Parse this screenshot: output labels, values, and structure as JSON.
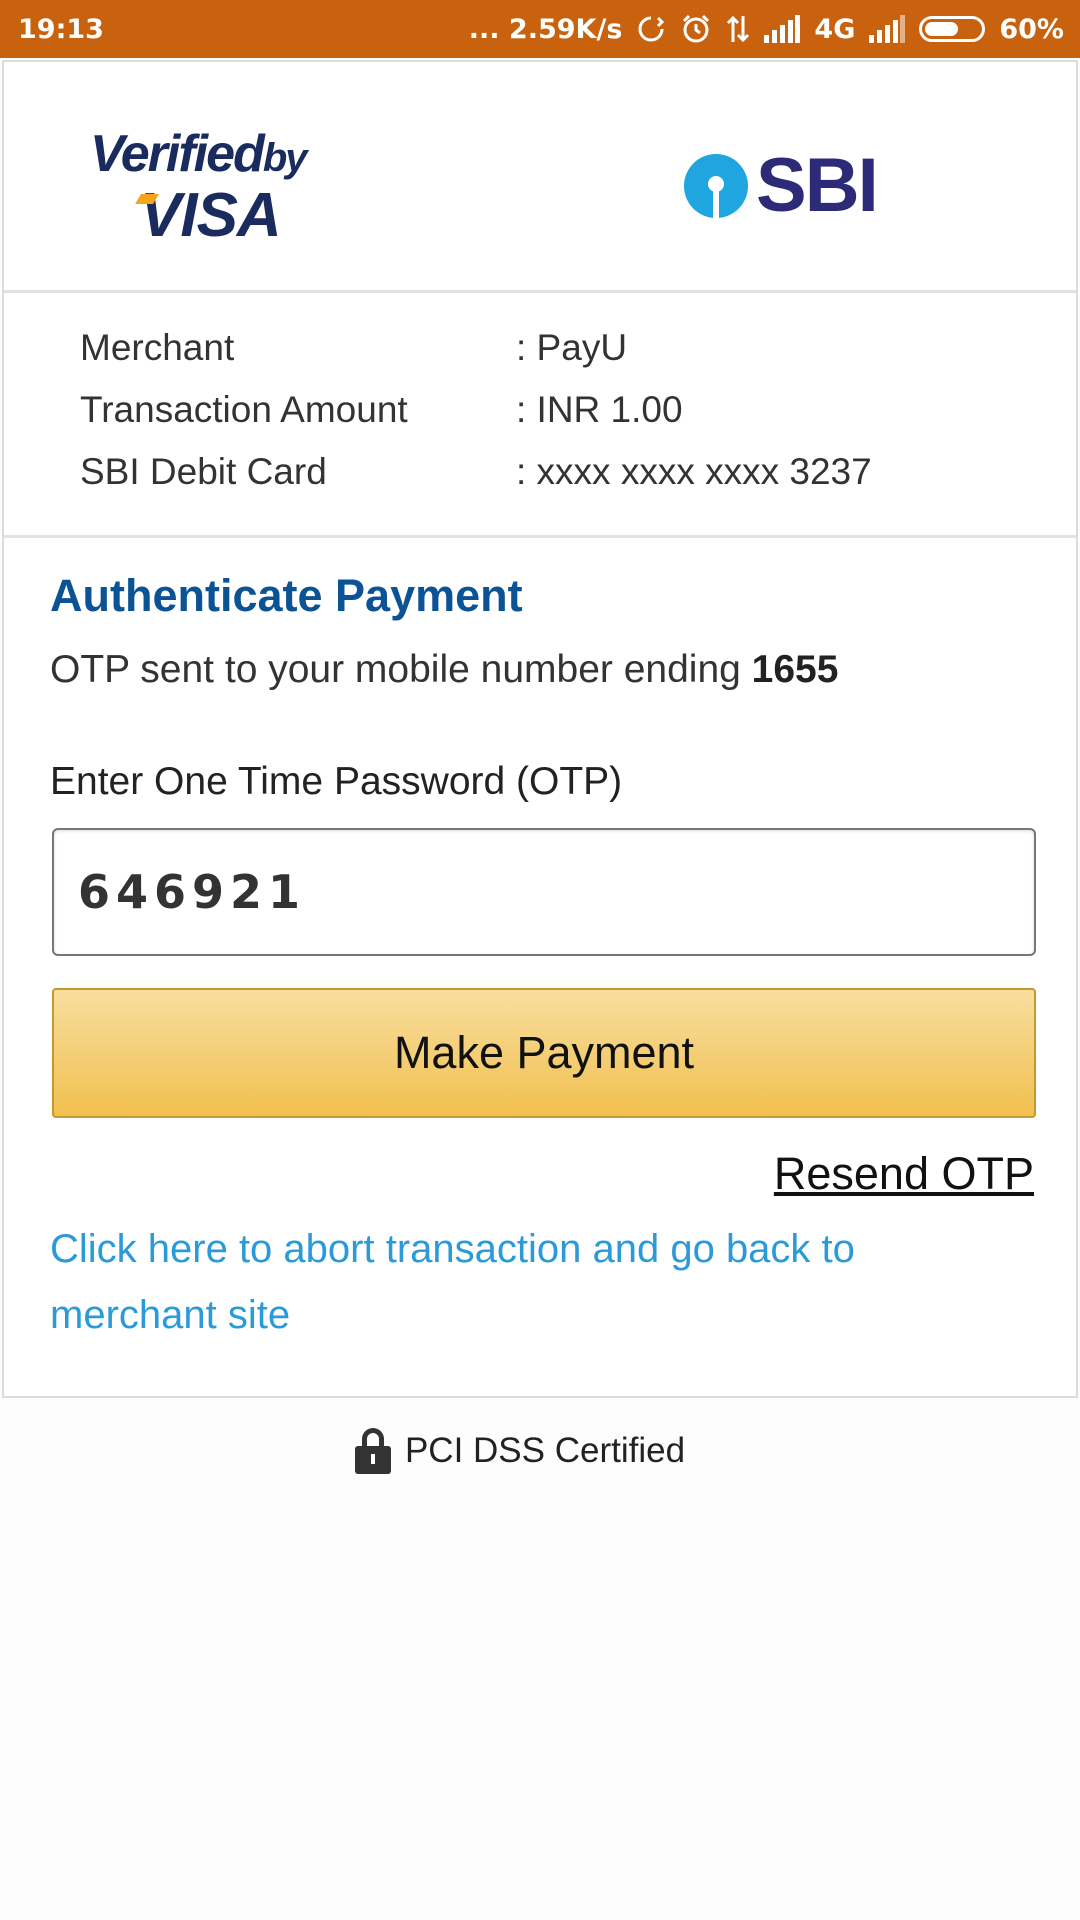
{
  "status_bar": {
    "time": "19:13",
    "network_speed": "... 2.59K/s",
    "network_type": "4G",
    "battery": "60%",
    "battery_level": 0.6,
    "icons": [
      "sync-icon",
      "alarm-icon",
      "data-transfer-icon",
      "signal-icon",
      "signal-icon-2",
      "battery-icon"
    ]
  },
  "logos": {
    "visa_line1": "Verified",
    "visa_by": "by",
    "visa_line2": "VISA",
    "bank": "SBI"
  },
  "details": [
    {
      "label": "Merchant",
      "value": ": PayU"
    },
    {
      "label": "Transaction Amount",
      "value": ":  INR 1.00"
    },
    {
      "label": "SBI Debit Card",
      "value": ": xxxx xxxx xxxx 3237"
    }
  ],
  "auth": {
    "title": "Authenticate Payment",
    "otp_sent_prefix": "OTP sent to your mobile number ending ",
    "otp_sent_number": "1655",
    "otp_label": "Enter One Time Password (OTP)",
    "otp_value": "646921",
    "pay_button": "Make Payment",
    "resend": "Resend OTP",
    "abort": "Click here to abort transaction and go back to merchant site"
  },
  "footer": {
    "pci": "PCI DSS Certified"
  },
  "colors": {
    "status_bar": "#c8620e",
    "title": "#0b5394",
    "link": "#2a9bd8",
    "button": "#f1c04f"
  }
}
